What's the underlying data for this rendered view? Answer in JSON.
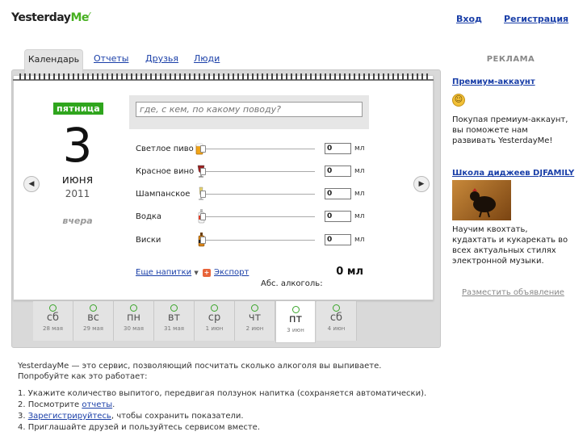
{
  "header": {
    "logo_left": "Yesterday",
    "logo_right": "Me",
    "login": "Вход",
    "register": "Регистрация"
  },
  "tabs": [
    {
      "label": "Календарь"
    },
    {
      "label": "Отчеты"
    },
    {
      "label": "Друзья"
    },
    {
      "label": "Люди"
    }
  ],
  "calendar": {
    "weekday": "пятница",
    "day": "3",
    "month": "июня",
    "year": "2011",
    "relative": "вчера"
  },
  "note": {
    "placeholder": "где, с кем, по какому поводу?"
  },
  "drinks": [
    {
      "name": "Светлое пиво",
      "value": "0",
      "unit": "мл",
      "icon": "beer-icon",
      "color": "#f0a51a"
    },
    {
      "name": "Красное вино",
      "value": "0",
      "unit": "мл",
      "icon": "wine-icon",
      "color": "#9c1f1f"
    },
    {
      "name": "Шампанское",
      "value": "0",
      "unit": "мл",
      "icon": "champagne-icon",
      "color": "#e8d36b"
    },
    {
      "name": "Водка",
      "value": "0",
      "unit": "мл",
      "icon": "vodka-icon",
      "color": "#d9402a"
    },
    {
      "name": "Виски",
      "value": "0",
      "unit": "мл",
      "icon": "whisky-icon",
      "color": "#d68214"
    }
  ],
  "actions": {
    "more": "Еще напитки",
    "export": "Экспорт"
  },
  "total": {
    "value": "0 мл",
    "label": "Абс. алкоголь:"
  },
  "days": [
    {
      "weekday": "сб",
      "date": "28 мая",
      "active": false
    },
    {
      "weekday": "вс",
      "date": "29 мая",
      "active": false
    },
    {
      "weekday": "пн",
      "date": "30 мая",
      "active": false
    },
    {
      "weekday": "вт",
      "date": "31 мая",
      "active": false
    },
    {
      "weekday": "ср",
      "date": "1 июн",
      "active": false
    },
    {
      "weekday": "чт",
      "date": "2 июн",
      "active": false
    },
    {
      "weekday": "пт",
      "date": "3 июн",
      "active": true
    },
    {
      "weekday": "сб",
      "date": "4 июн",
      "active": false
    }
  ],
  "ads": {
    "header": "РЕКЛАМА",
    "ad1": {
      "title": "Премиум-аккаунт",
      "text": "Покупая премиум-аккаунт, вы поможете нам развивать YesterdayMe!"
    },
    "ad2": {
      "title": "Школа диджеев DJFAMILY",
      "text": "Научим квохтать, кудахтать и кукарекать во всех актуальных стилях электронной музыки."
    },
    "place": "Разместить объявление"
  },
  "intro": {
    "text1": "YesterdayMe — это сервис, позволяющий посчитать сколько алкоголя вы выпиваете.",
    "text2": "Попробуйте как это работает:"
  },
  "steps": {
    "s1": "1.  Укажите количество выпитого, передвигая ползунок напитка (сохраняется автоматически).",
    "s2_pre": "2.  Посмотрите ",
    "s2_link": "отчеты",
    "s2_post": ".",
    "s3_pre": "3.  ",
    "s3_link": "Зарегистрируйтесь",
    "s3_post": ", чтобы сохранить показатели.",
    "s4": "4.  Приглашайте друзей и пользуйтесь сервисом вместе."
  }
}
